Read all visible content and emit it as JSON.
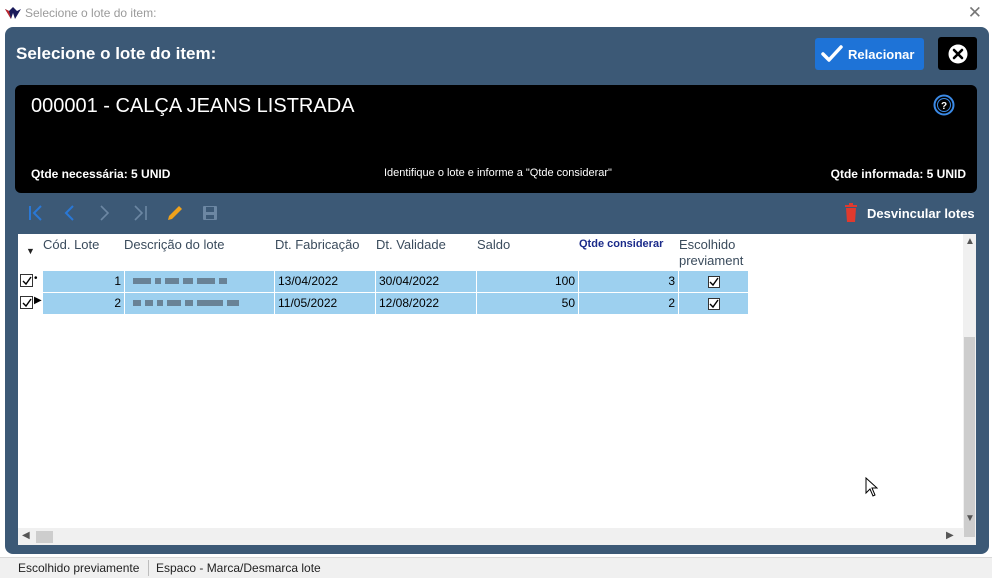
{
  "window": {
    "title": "Selecione o lote do item:"
  },
  "dialog": {
    "title": "Selecione o lote do item:",
    "relacionar_label": "Relacionar"
  },
  "item": {
    "name": "000001 - CALÇA JEANS LISTRADA",
    "qtde_necessaria": "Qtde necessária: 5 UNID",
    "hint": "Identifique o lote e informe a \"Qtde considerar\"",
    "qtde_informada": "Qtde informada: 5 UNID"
  },
  "toolbar": {
    "desvincular_label": "Desvincular lotes"
  },
  "grid": {
    "columns": [
      "Cód. Lote",
      "Descrição do lote",
      "Dt. Fabricação",
      "Dt. Validade",
      "Saldo",
      "Qtde considerar",
      "Escolhido previament"
    ],
    "rows": [
      {
        "cod": "1",
        "fabricacao": "13/04/2022",
        "validade": "30/04/2022",
        "saldo": "100",
        "qtde": "3",
        "escolhido": true
      },
      {
        "cod": "2",
        "fabricacao": "11/05/2022",
        "validade": "12/08/2022",
        "saldo": "50",
        "qtde": "2",
        "escolhido": true
      }
    ]
  },
  "statusbar": {
    "left": "Escolhido previamente",
    "right": "Espaco - Marca/Desmarca lote"
  },
  "colors": {
    "dialog_bg": "#3c5976",
    "row_highlight": "#9dd0ef",
    "relacionar_bg": "#1e73d7",
    "trash": "#e03a2e",
    "edit": "#f0a21b",
    "nav_blue": "#2a78d6"
  }
}
